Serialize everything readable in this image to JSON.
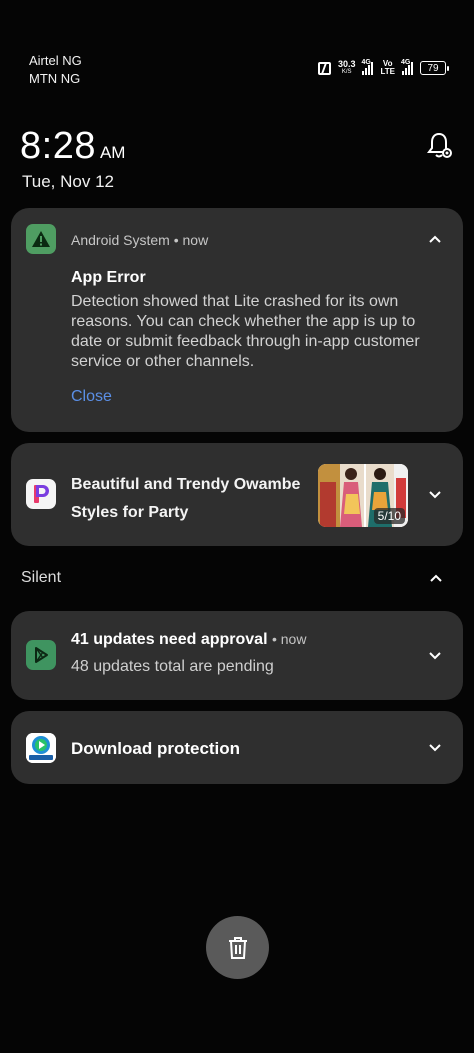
{
  "status_bar": {
    "carrier1": "Airtel NG",
    "carrier2": "MTN NG",
    "net_speed": "30.3",
    "net_speed_unit": "K/S",
    "sim1_type": "4G",
    "volte_top": "Vo",
    "volte_bottom": "LTE",
    "sim2_type": "4G",
    "battery": "79",
    "icons": [
      "nfc-icon",
      "signal-icon",
      "signal-icon",
      "battery-icon"
    ]
  },
  "clock": {
    "time": "8:28",
    "ampm": "AM",
    "date": "Tue, Nov 12"
  },
  "notifications": [
    {
      "app": "Android System",
      "time": "now",
      "title": "App Error",
      "body": "Detection showed that Lite crashed for its own reasons. You can check whether the app is up to date or submit feedback through in-app customer service or other channels.",
      "action": "Close",
      "icon": "warning-icon",
      "icon_color": "#4f9d62",
      "action_color": "#5b8fe6"
    },
    {
      "title": "Beautiful and Trendy Owambe Styles for Party",
      "image_count": "5/10",
      "icon": "p-app-icon"
    }
  ],
  "silent_section": {
    "label": "Silent",
    "items": [
      {
        "title": "41 updates need approval",
        "time": "now",
        "subtitle": "48 updates total are pending",
        "icon": "play-store-icon"
      },
      {
        "title": "Download protection",
        "icon": "media-app-icon"
      }
    ]
  },
  "clear_button": {
    "icon": "trash-icon"
  },
  "colors": {
    "background": "#050505",
    "card": "#2f2f2f",
    "accent": "#5b8fe6"
  }
}
